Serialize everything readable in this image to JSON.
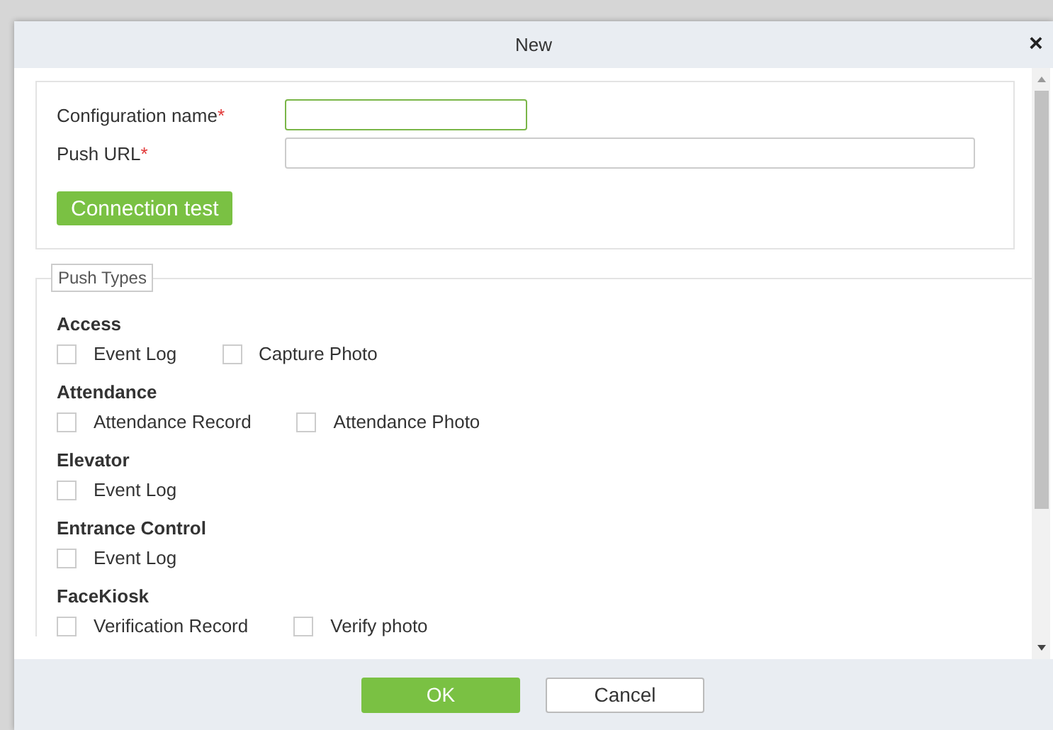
{
  "window": {
    "title": "New",
    "close": "×"
  },
  "connection": {
    "fields": [
      {
        "label": "Configuration name",
        "required": "*",
        "focused": true
      },
      {
        "label": "Push URL",
        "required": "*",
        "focused": false
      }
    ],
    "test_button": "Connection test"
  },
  "push_types": {
    "legend": "Push Types",
    "groups": [
      {
        "title": "Access",
        "options": [
          {
            "label": "Event Log",
            "checked": false
          },
          {
            "label": "Capture Photo",
            "checked": false
          }
        ]
      },
      {
        "title": "Attendance",
        "options": [
          {
            "label": "Attendance Record",
            "checked": false
          },
          {
            "label": "Attendance Photo",
            "checked": false
          }
        ]
      },
      {
        "title": "Elevator",
        "options": [
          {
            "label": "Event Log",
            "checked": false
          }
        ]
      },
      {
        "title": "Entrance Control",
        "options": [
          {
            "label": "Event Log",
            "checked": false
          }
        ]
      },
      {
        "title": "FaceKiosk",
        "options": [
          {
            "label": "Verification Record",
            "checked": false
          },
          {
            "label": "Verify photo",
            "checked": false
          }
        ]
      }
    ]
  },
  "buttons": [
    {
      "label": "OK",
      "kind": "primary"
    },
    {
      "label": "Cancel",
      "kind": "secondary"
    }
  ]
}
